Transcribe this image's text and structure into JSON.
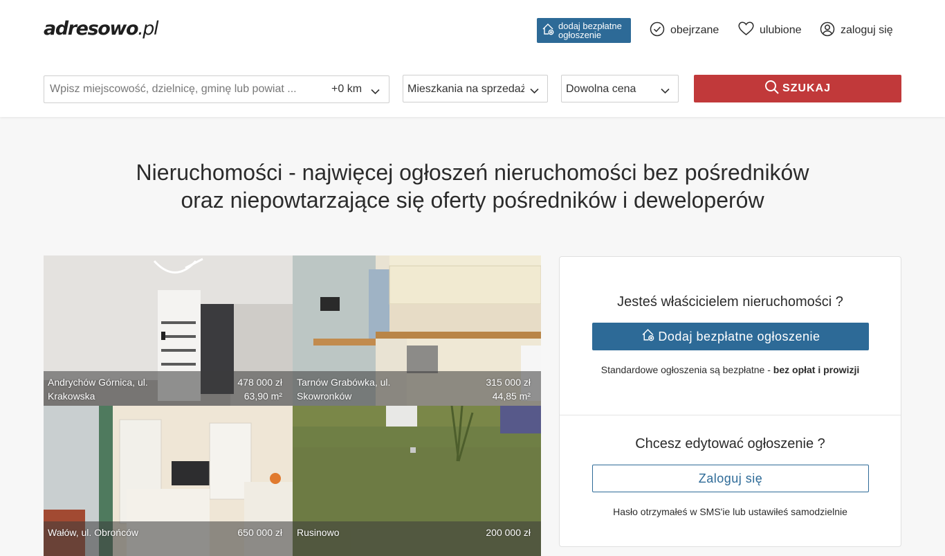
{
  "header": {
    "logo_main": "adresowo",
    "logo_suffix": ".pl",
    "add_listing_line1": "dodaj bezpłatne",
    "add_listing_line2": "ogłoszenie",
    "nav": {
      "viewed": "obejrzane",
      "favorites": "ulubione",
      "login": "zaloguj się"
    }
  },
  "search": {
    "placeholder": "Wpisz miejscowość, dzielnicę, gminę lub powiat ...",
    "radius": "+0 km",
    "category": "Mieszkania na sprzedaż",
    "price": "Dowolna cena",
    "button": "SZUKAJ"
  },
  "headline": {
    "line1": "Nieruchomości - najwięcej ogłoszeń nieruchomości bez pośredników",
    "line2": "oraz niepowtarzające się oferty pośredników i deweloperów"
  },
  "listings": [
    {
      "location": "Andrychów Górnica, ul. Krakowska",
      "price": "478 000 zł",
      "area": "63,90 m²"
    },
    {
      "location": "Tarnów Grabówka, ul. Skowronków",
      "price": "315 000 zł",
      "area": "44,85 m²"
    },
    {
      "location": "Wałów, ul. Obrońców",
      "price": "650 000 zł",
      "area": ""
    },
    {
      "location": "Rusinowo",
      "price": "200 000 zł",
      "area": ""
    }
  ],
  "owner_panel": {
    "question1": "Jesteś właścicielem nieruchomości ?",
    "add_button": "Dodaj bezpłatne ogłoszenie",
    "note1_prefix": "Standardowe ogłoszenia są bezpłatne - ",
    "note1_bold": "bez opłat i prowizji",
    "question2": "Chcesz edytować ogłoszenie ?",
    "login_button": "Zaloguj się",
    "note2": "Hasło otrzymałeś w SMS'ie lub ustawiłeś samodzielnie"
  },
  "colors": {
    "brand_blue": "#2d6a97",
    "search_red": "#c1393a",
    "page_bg": "#f7f7f7"
  }
}
